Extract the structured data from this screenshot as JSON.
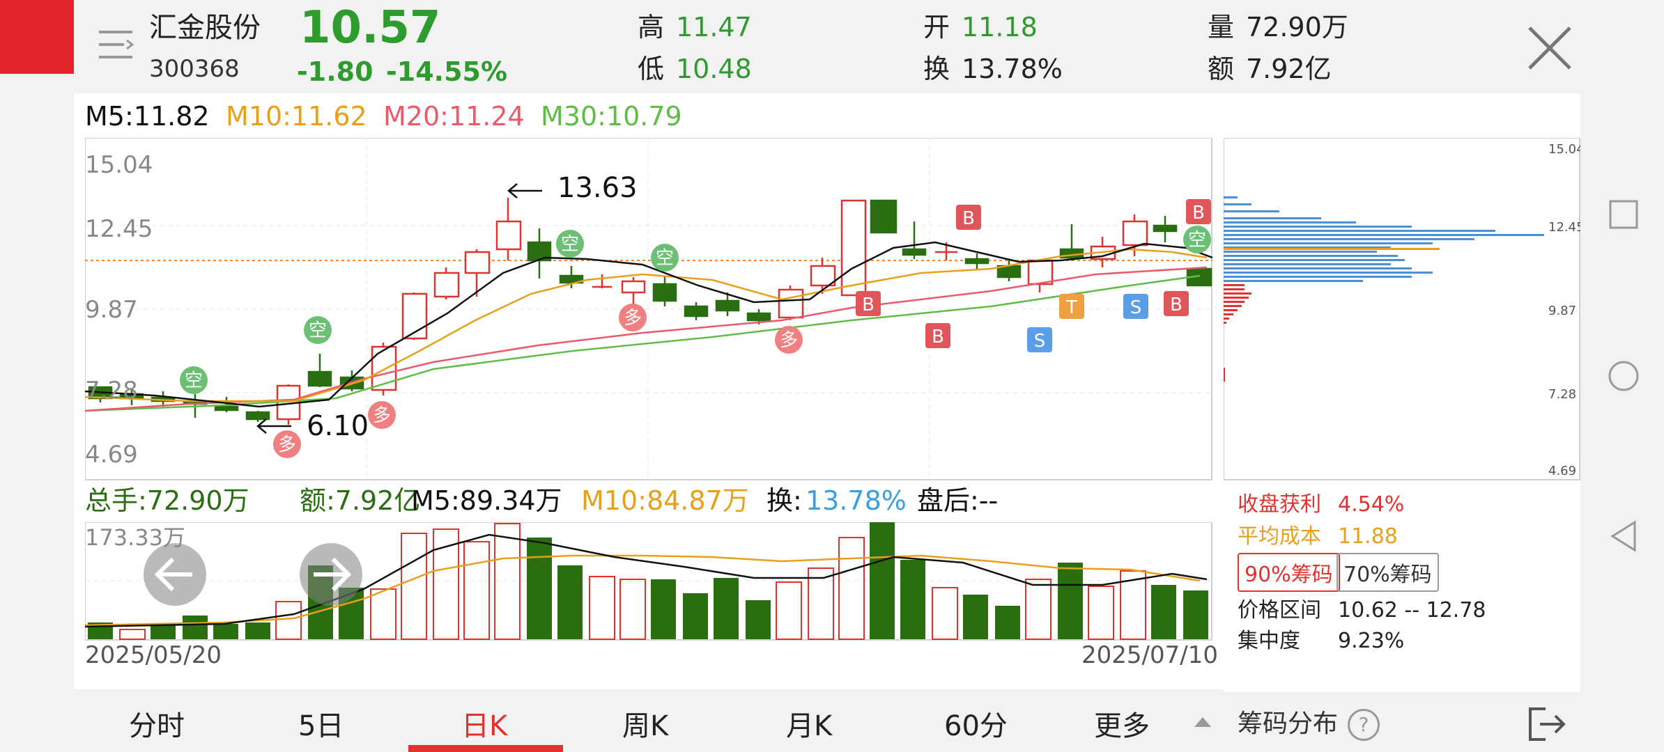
{
  "header": {
    "stock_name": "汇金股份",
    "stock_code": "300368",
    "price": "10.57",
    "change": "-1.80",
    "change_pct": "-14.55%",
    "high_label": "高",
    "high": "11.47",
    "low_label": "低",
    "low": "10.48",
    "open_label": "开",
    "open": "11.18",
    "turnover_label": "换",
    "turnover": "13.78%",
    "volume_label": "量",
    "volume": "72.90万",
    "amount_label": "额",
    "amount": "7.92亿"
  },
  "ma_legend": {
    "m5": "M5:11.82",
    "m10": "M10:11.62",
    "m20": "M20:11.24",
    "m30": "M30:10.79"
  },
  "price_axis": [
    "15.04",
    "12.45",
    "9.87",
    "7.28",
    "4.69"
  ],
  "annotations": {
    "high_marker": "13.63",
    "low_marker": "6.10"
  },
  "vol_legend": {
    "total": "总手:72.90万",
    "amount": "额:7.92亿",
    "m5": "M5:89.34万",
    "m10": "M10:84.87万",
    "turnover_label": "换:",
    "turnover": "13.78%",
    "after_hours": "盘后:--"
  },
  "vol_axis_max": "173.33万",
  "dates": {
    "start": "2025/05/20",
    "end": "2025/07/10"
  },
  "tabs": [
    "分时",
    "5日",
    "日K",
    "周K",
    "月K",
    "60分",
    "更多"
  ],
  "active_tab": "日K",
  "chip": {
    "axis": [
      "15.04",
      "12.45",
      "9.87",
      "7.28",
      "4.69"
    ],
    "profit_label": "收盘获利",
    "profit": "4.54%",
    "avgcost_label": "平均成本",
    "avgcost": "11.88",
    "btn90": "90%筹码",
    "btn70": "70%筹码",
    "range_label": "价格区间",
    "range": "10.62 -- 12.78",
    "conc_label": "集中度",
    "conc": "9.23%",
    "footer": "筹码分布",
    "help": "?"
  },
  "signal_labels": {
    "buy": "B",
    "sell": "S",
    "t": "T",
    "long": "多",
    "short": "空"
  },
  "colors": {
    "up": "#e0332f",
    "down": "#2b6e12",
    "m5": "#111111",
    "m10": "#e8a01a",
    "m20": "#ea5a6b",
    "m30": "#5fbd47",
    "accent": "#e2232a"
  }
}
